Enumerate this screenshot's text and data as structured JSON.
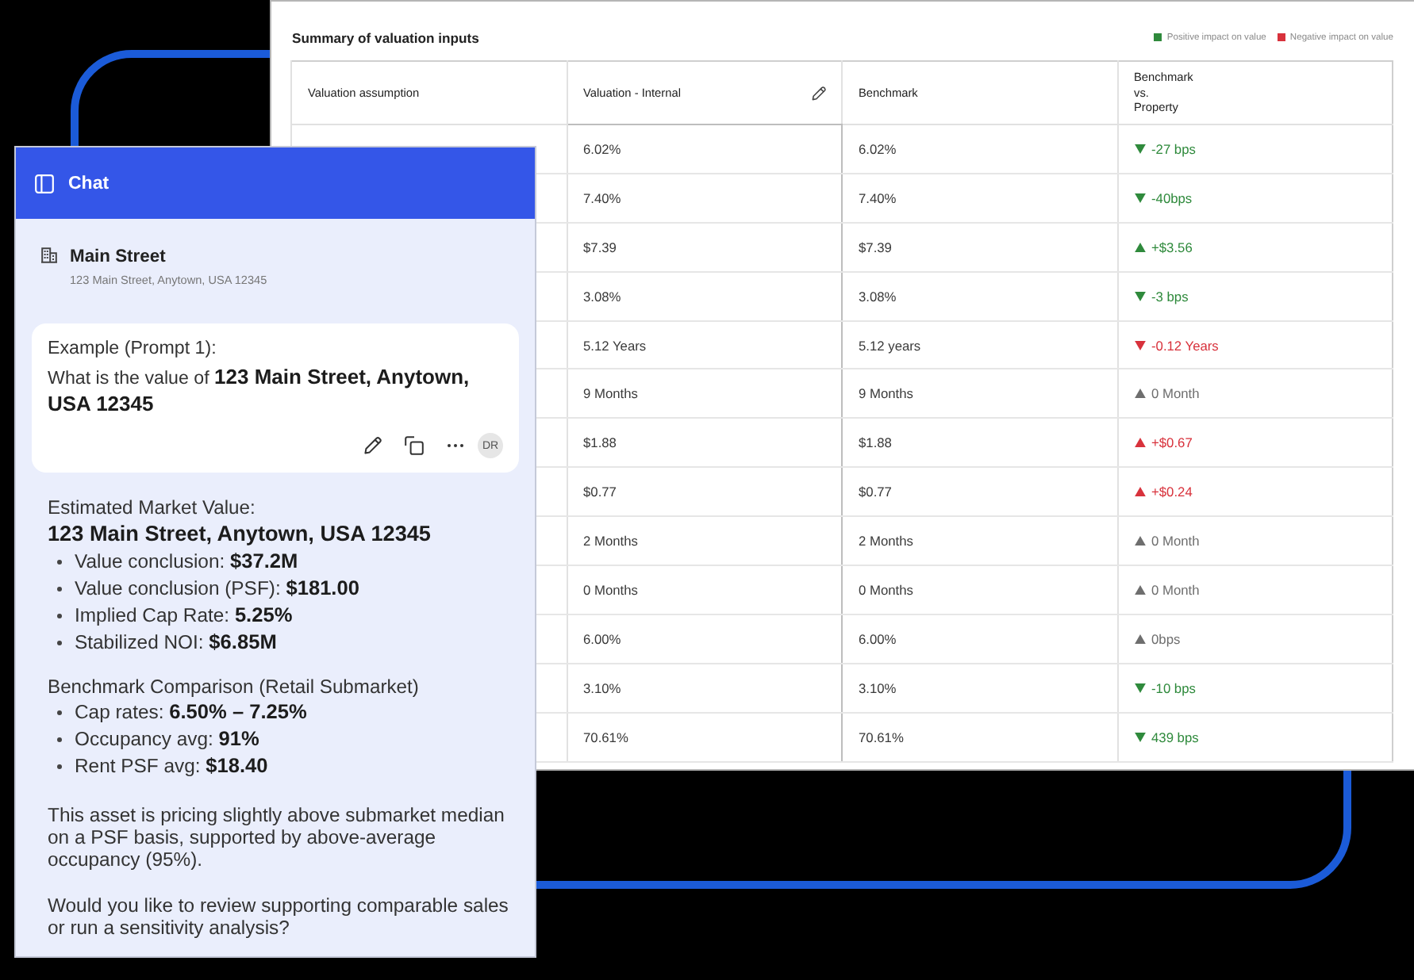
{
  "table_panel": {
    "title": "Summary of valuation inputs",
    "legend": [
      {
        "label": "Positive impact on value",
        "color": "#2f8a3c"
      },
      {
        "label": "Negative impact on value",
        "color": "#d8323c"
      }
    ],
    "columns": [
      {
        "label": "Valuation assumption",
        "editable": false
      },
      {
        "label": "Valuation - Internal",
        "editable": true
      },
      {
        "label": "Benchmark",
        "editable": false
      },
      {
        "label": "Benchmark vs. Property",
        "editable": false
      }
    ],
    "rows": [
      {
        "internal": "6.02%",
        "benchmark": "6.02%",
        "delta": {
          "text": "-27 bps",
          "kind": "down",
          "color": "#2f8a3c"
        }
      },
      {
        "internal": "7.40%",
        "benchmark": "7.40%",
        "delta": {
          "text": "-40bps",
          "kind": "down",
          "color": "#2f8a3c"
        }
      },
      {
        "internal": "$7.39",
        "benchmark": "$7.39",
        "delta": {
          "text": "+$3.56",
          "kind": "up",
          "color": "#2f8a3c"
        }
      },
      {
        "internal": "3.08%",
        "benchmark": "3.08%",
        "delta": {
          "text": "-3 bps",
          "kind": "down",
          "color": "#2f8a3c"
        }
      },
      {
        "internal": "5.12 Years",
        "benchmark": "5.12 years",
        "delta": {
          "text": "-0.12 Years",
          "kind": "down",
          "color": "#d8323c"
        }
      },
      {
        "internal": "9 Months",
        "benchmark": "9 Months",
        "delta": {
          "text": "0 Month",
          "kind": "up",
          "color": "#6e6e6e"
        }
      },
      {
        "internal": "$1.88",
        "benchmark": "$1.88",
        "delta": {
          "text": "+$0.67",
          "kind": "up",
          "color": "#d8323c"
        }
      },
      {
        "internal": "$0.77",
        "benchmark": "$0.77",
        "delta": {
          "text": "+$0.24",
          "kind": "up",
          "color": "#d8323c"
        }
      },
      {
        "internal": "2 Months",
        "benchmark": "2 Months",
        "delta": {
          "text": "0 Month",
          "kind": "up",
          "color": "#6e6e6e"
        }
      },
      {
        "internal": "0 Months",
        "benchmark": "0 Months",
        "delta": {
          "text": "0 Month",
          "kind": "up",
          "color": "#6e6e6e"
        }
      },
      {
        "internal": "6.00%",
        "benchmark": "6.00%",
        "delta": {
          "text": "0bps",
          "kind": "up",
          "color": "#6e6e6e"
        }
      },
      {
        "internal": "3.10%",
        "benchmark": "3.10%",
        "delta": {
          "text": "-10 bps",
          "kind": "down",
          "color": "#2f8a3c"
        }
      },
      {
        "internal": "70.61%",
        "benchmark": "70.61%",
        "delta": {
          "text": "439 bps",
          "kind": "down",
          "color": "#2f8a3c"
        }
      }
    ]
  },
  "chat": {
    "title": "Chat",
    "property": {
      "name": "Main Street",
      "address": "123 Main Street, Anytown, USA 12345"
    },
    "prompt": {
      "label": "Example (Prompt 1):",
      "text": "What is the value of **123 Main Street, Anytown, USA 12345**",
      "avatar": "DR"
    },
    "response": {
      "sections": [
        {
          "heading": "Estimated Market Value:",
          "subheading": "123 Main Street, Anytown, USA 12345",
          "bullets": [
            "Value conclusion: **$37.2M**",
            "Value conclusion (PSF): **$181.00**",
            "Implied Cap Rate: **5.25%**",
            "Stabilized NOI: **$6.85M**"
          ]
        },
        {
          "heading": "Benchmark Comparison (Retail Submarket)",
          "bullets": [
            "Cap rates: **6.50% – 7.25%**",
            "Occupancy avg: **91%**",
            "Rent PSF avg: **$18.40**"
          ]
        }
      ],
      "paragraphs": [
        "This asset is pricing slightly above submarket median on a PSF basis, supported by above-average occupancy (95%).",
        "Would you like to review supporting comparable sales or run a sensitivity analysis?"
      ]
    }
  }
}
